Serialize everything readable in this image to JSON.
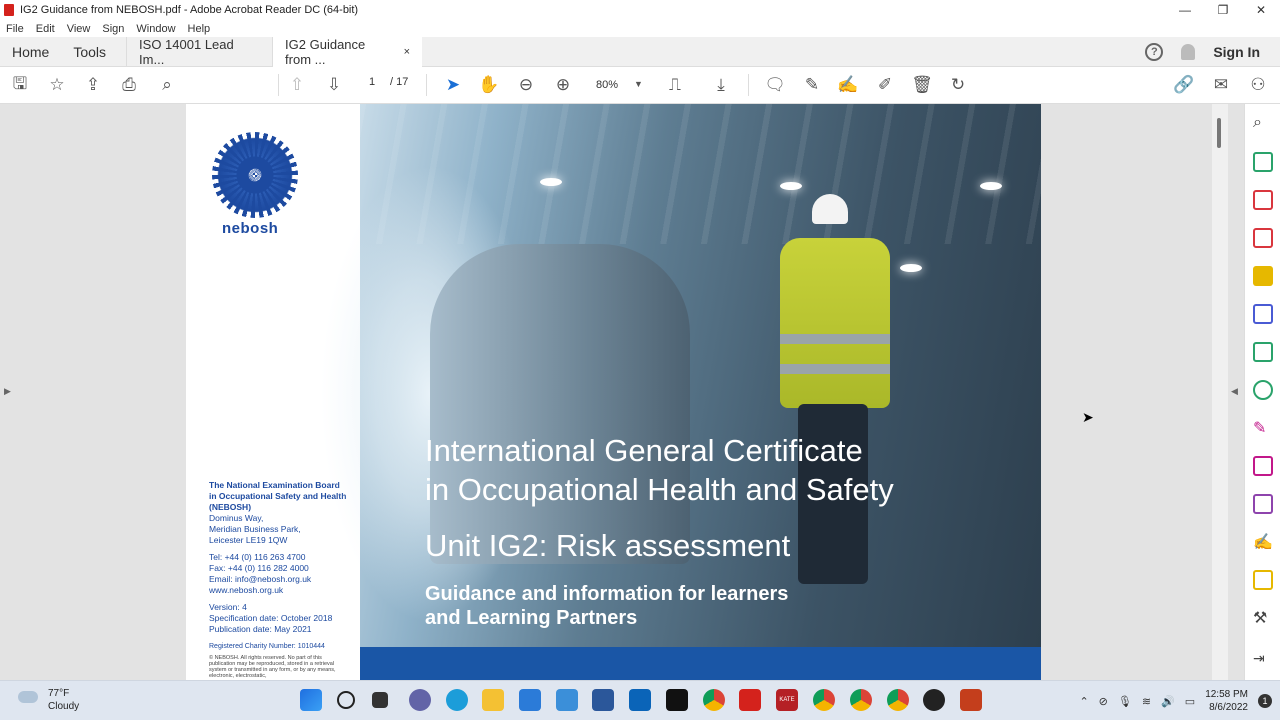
{
  "window": {
    "title": "IG2 Guidance from NEBOSH.pdf - Adobe Acrobat Reader DC (64-bit)"
  },
  "menu": [
    "File",
    "Edit",
    "View",
    "Sign",
    "Window",
    "Help"
  ],
  "tabs": {
    "home": "Home",
    "tools": "Tools",
    "docs": [
      {
        "label": "ISO 14001 Lead Im..."
      },
      {
        "label": "IG2 Guidance from ..."
      }
    ],
    "close": "×",
    "sign_in": "Sign In"
  },
  "toolbar": {
    "page_current": "1",
    "page_sep": "/ 17",
    "zoom": "80%"
  },
  "document": {
    "logo_text": "nebosh",
    "org_name": "The National Examination Board in Occupational Safety and Health (NEBOSH)",
    "address": [
      "Dominus Way,",
      "Meridian Business Park,",
      "Leicester LE19 1QW"
    ],
    "contact": [
      "Tel: +44 (0) 116 263 4700",
      "Fax: +44 (0) 116 282 4000",
      "Email: info@nebosh.org.uk",
      "www.nebosh.org.uk"
    ],
    "version": [
      "Version: 4",
      "Specification date: October 2018",
      "Publication date: May 2021"
    ],
    "charity": "Registered Charity Number: 1010444",
    "copyright": "© NEBOSH. All rights reserved. No part of this publication may be reproduced, stored in a retrieval system or transmitted in any form, or by any means, electronic, electrostatic,",
    "title_line1": "International General Certificate",
    "title_line2": "in Occupational Health and Safety",
    "unit": "Unit IG2: Risk assessment",
    "subtitle_line1": "Guidance and information for learners",
    "subtitle_line2": "and Learning Partners"
  },
  "taskbar": {
    "temp": "77°F",
    "condition": "Cloudy",
    "time": "12:58 PM",
    "date": "8/6/2022",
    "notifications": "1"
  }
}
